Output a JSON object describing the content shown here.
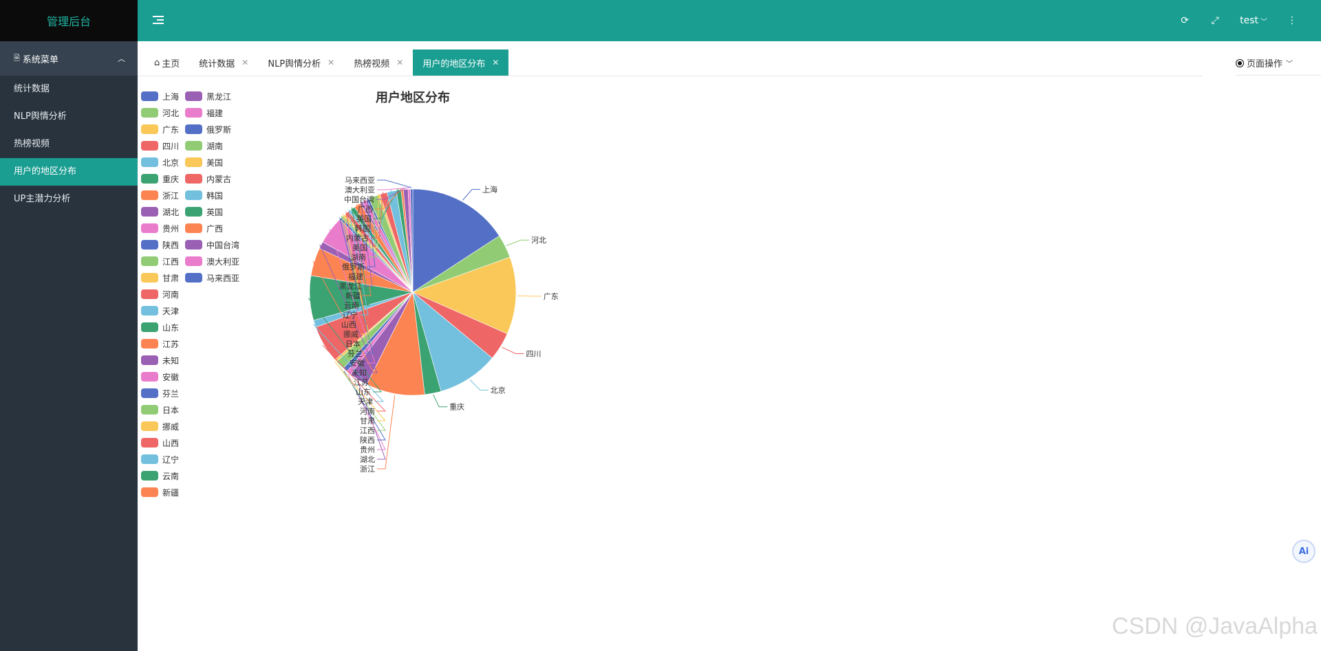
{
  "app": {
    "title": "管理后台"
  },
  "sidebar": {
    "menu_title": "系统菜单",
    "items": [
      {
        "label": "统计数据",
        "active": false
      },
      {
        "label": "NLP舆情分析",
        "active": false
      },
      {
        "label": "热榜视频",
        "active": false
      },
      {
        "label": "用户的地区分布",
        "active": true
      },
      {
        "label": "UP主潜力分析",
        "active": false
      }
    ]
  },
  "topbar": {
    "user": "test",
    "icons": [
      "refresh-icon",
      "fullscreen-icon",
      "more-icon"
    ]
  },
  "tabs": [
    {
      "label": "主页",
      "closable": false,
      "active": false
    },
    {
      "label": "统计数据",
      "closable": true,
      "active": false
    },
    {
      "label": "NLP舆情分析",
      "closable": true,
      "active": false
    },
    {
      "label": "热榜视频",
      "closable": true,
      "active": false
    },
    {
      "label": "用户的地区分布",
      "closable": true,
      "active": true
    }
  ],
  "page_ops": {
    "label": "页面操作"
  },
  "colors": {
    "accent": "#1b9e92",
    "sidebar": "#28333e",
    "palette": [
      "#5470c6",
      "#91cc75",
      "#fac858",
      "#ee6666",
      "#73c0de",
      "#3ba272",
      "#fc8452",
      "#9a60b4",
      "#ea7ccc"
    ]
  },
  "chart_data": {
    "type": "pie",
    "title": "用户地区分布",
    "legend_position": "left",
    "categories": [
      "上海",
      "河北",
      "广东",
      "四川",
      "北京",
      "重庆",
      "浙江",
      "湖北",
      "贵州",
      "陕西",
      "江西",
      "甘肃",
      "河南",
      "天津",
      "山东",
      "江苏",
      "未知",
      "安徽",
      "芬兰",
      "日本",
      "挪威",
      "山西",
      "辽宁",
      "云南",
      "新疆",
      "黑龙江",
      "福建",
      "俄罗斯",
      "湖南",
      "美国",
      "内蒙古",
      "韩国",
      "英国",
      "广西",
      "中国台湾",
      "澳大利亚",
      "马来西亚"
    ],
    "values": [
      43,
      10,
      33,
      12,
      26,
      7,
      25,
      8,
      2,
      2,
      4,
      1,
      16,
      3,
      19,
      12,
      3,
      12,
      1,
      1,
      1,
      2,
      1,
      2,
      3,
      1,
      2,
      1,
      4,
      1,
      3,
      4,
      2,
      1,
      2,
      1,
      1
    ]
  },
  "ai_button": {
    "label": "Ai"
  },
  "watermark": "CSDN @JavaAlpha"
}
